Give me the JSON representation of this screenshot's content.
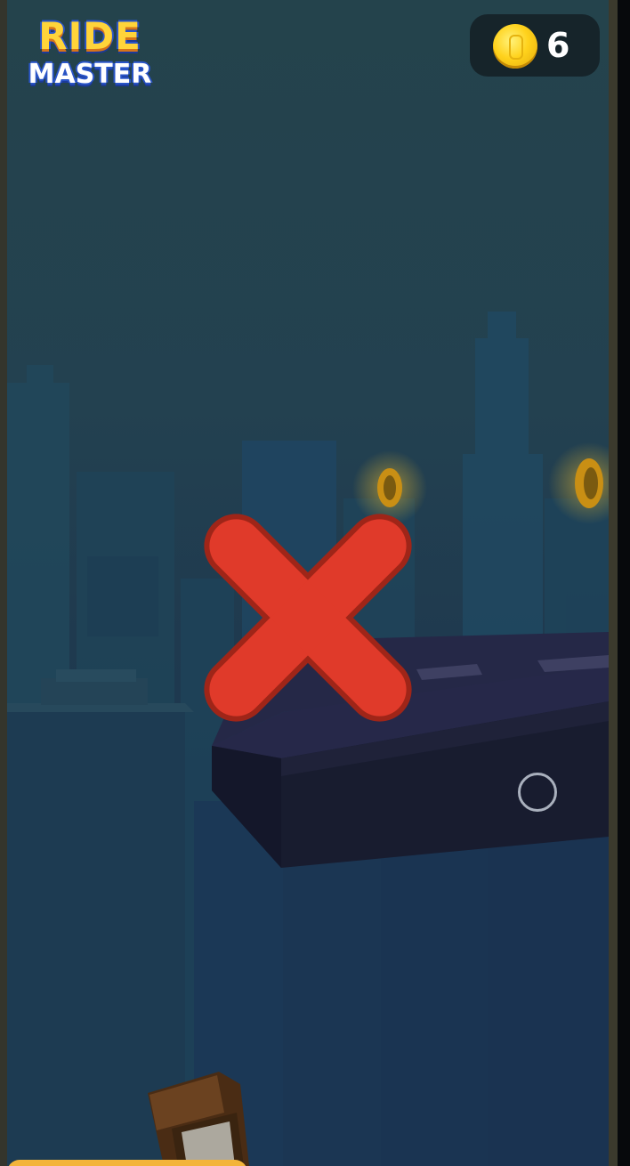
{
  "logo": {
    "line1": "RIDE",
    "line2": "MASTER"
  },
  "hud": {
    "coin_count": "6",
    "coin_icon": "gold-coin-icon"
  },
  "overlay": {
    "result_icon": "red-x-fail-icon"
  },
  "colors": {
    "fail_red": "#e13a2b",
    "coin_gold": "#ffd21c",
    "accent_orange": "#f3b43a"
  }
}
